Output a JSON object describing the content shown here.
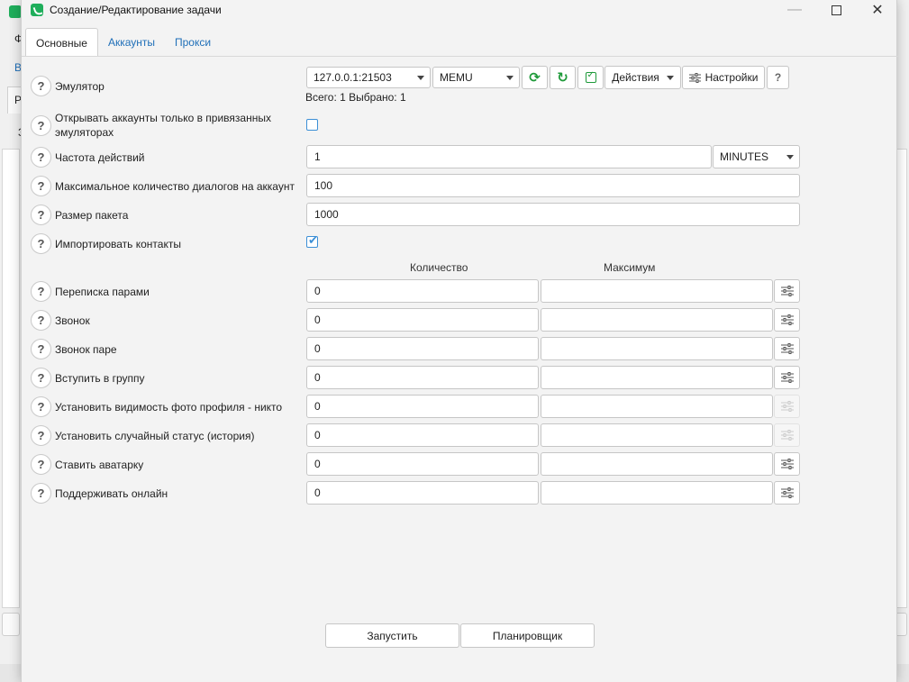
{
  "window": {
    "title": "Создание/Редактирование задачи",
    "icon": "phone-app-icon",
    "accent": "#1fae5b"
  },
  "tabs": [
    {
      "label": "Основные",
      "active": true
    },
    {
      "label": "Аккаунты",
      "active": false
    },
    {
      "label": "Прокси",
      "active": false
    }
  ],
  "emulator": {
    "label": "Эмулятор",
    "address": "127.0.0.1:21503",
    "type": "MEMU",
    "actions_label": "Действия",
    "settings_label": "Настройки",
    "help_label": "?",
    "summary": "Всего: 1  Выбрано: 1"
  },
  "options": {
    "bound_only_label": "Открывать аккаунты только в привязанных эмуляторах",
    "bound_only_checked": false,
    "frequency_label": "Частота действий",
    "frequency_value": "1",
    "frequency_unit": "MINUTES",
    "max_dialogs_label": "Максимальное количество диалогов на аккаунт",
    "max_dialogs_value": "100",
    "batch_label": "Размер пакета",
    "batch_value": "1000",
    "import_label": "Импортировать контакты",
    "import_checked": true
  },
  "columns": {
    "count": "Количество",
    "max": "Максимум"
  },
  "actions": [
    {
      "label": "Переписка парами",
      "count": "0",
      "max": "",
      "tune_enabled": true
    },
    {
      "label": "Звонок",
      "count": "0",
      "max": "",
      "tune_enabled": true
    },
    {
      "label": "Звонок паре",
      "count": "0",
      "max": "",
      "tune_enabled": true
    },
    {
      "label": "Вступить в группу",
      "count": "0",
      "max": "",
      "tune_enabled": true
    },
    {
      "label": "Установить видимость фото профиля - никто",
      "count": "0",
      "max": "",
      "tune_enabled": false
    },
    {
      "label": "Установить случайный статус (история)",
      "count": "0",
      "max": "",
      "tune_enabled": false
    },
    {
      "label": "Ставить аватарку",
      "count": "0",
      "max": "",
      "tune_enabled": true
    },
    {
      "label": "Поддерживать онлайн",
      "count": "0",
      "max": "",
      "tune_enabled": true
    }
  ],
  "footer": {
    "run_label": "Запустить",
    "scheduler_label": "Планировщик"
  },
  "background": {
    "menu_letter": "Ф",
    "link_letter": "В",
    "tab_letter": "Р",
    "item_letter": "З"
  }
}
